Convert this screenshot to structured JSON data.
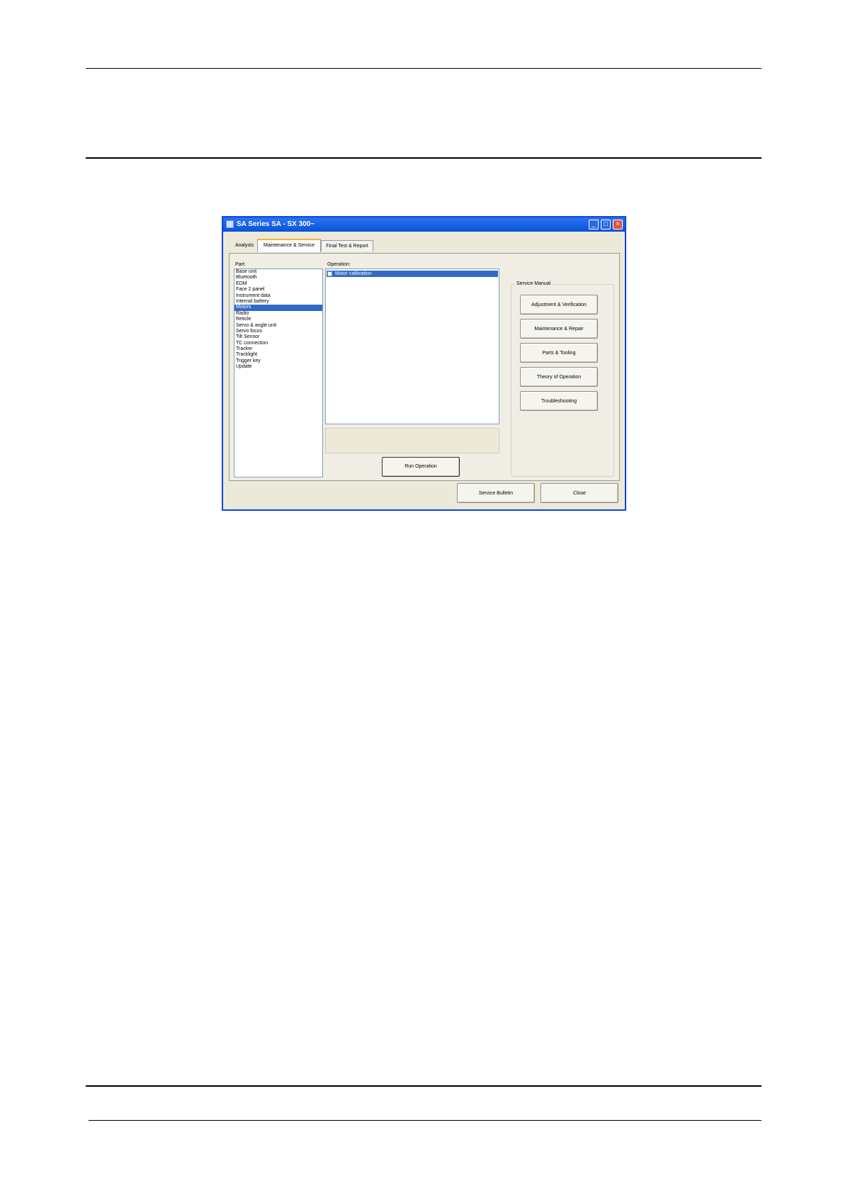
{
  "window": {
    "title": "SA Series SA - SX 300~"
  },
  "tabs": [
    "Analysis",
    "Maintenance & Service",
    "Final Test & Report"
  ],
  "labels": {
    "part": "Part:",
    "operation": "Operation:",
    "service_manual": "Service Manual"
  },
  "parts": [
    "Base unit",
    "Bluetooth",
    "EDM",
    "Face 2 panel",
    "Instrument data",
    "Internal battery",
    "Motors",
    "Radio",
    "Reticle",
    "Servo & angle unit",
    "Servo focus",
    "Tilt Sensor",
    "TC connection",
    "Tracker",
    "Tracklight",
    "Trigger key",
    "Update"
  ],
  "selected_part_index": 6,
  "operations": [
    "Motor calibration"
  ],
  "buttons": {
    "run_operation": "Run Operation",
    "adjustment": "Adjustment & Verification",
    "maintenance": "Maintenance & Repair",
    "parts": "Parts & Tooling",
    "theory": "Theory of Operation",
    "troubleshooting": "Troubleshooting",
    "service_bulletin": "Service Bulletin",
    "close": "Close"
  },
  "colors": {
    "titlebar": "#0a52d6",
    "selection": "#316ac5",
    "window_bg": "#ece9d8"
  }
}
